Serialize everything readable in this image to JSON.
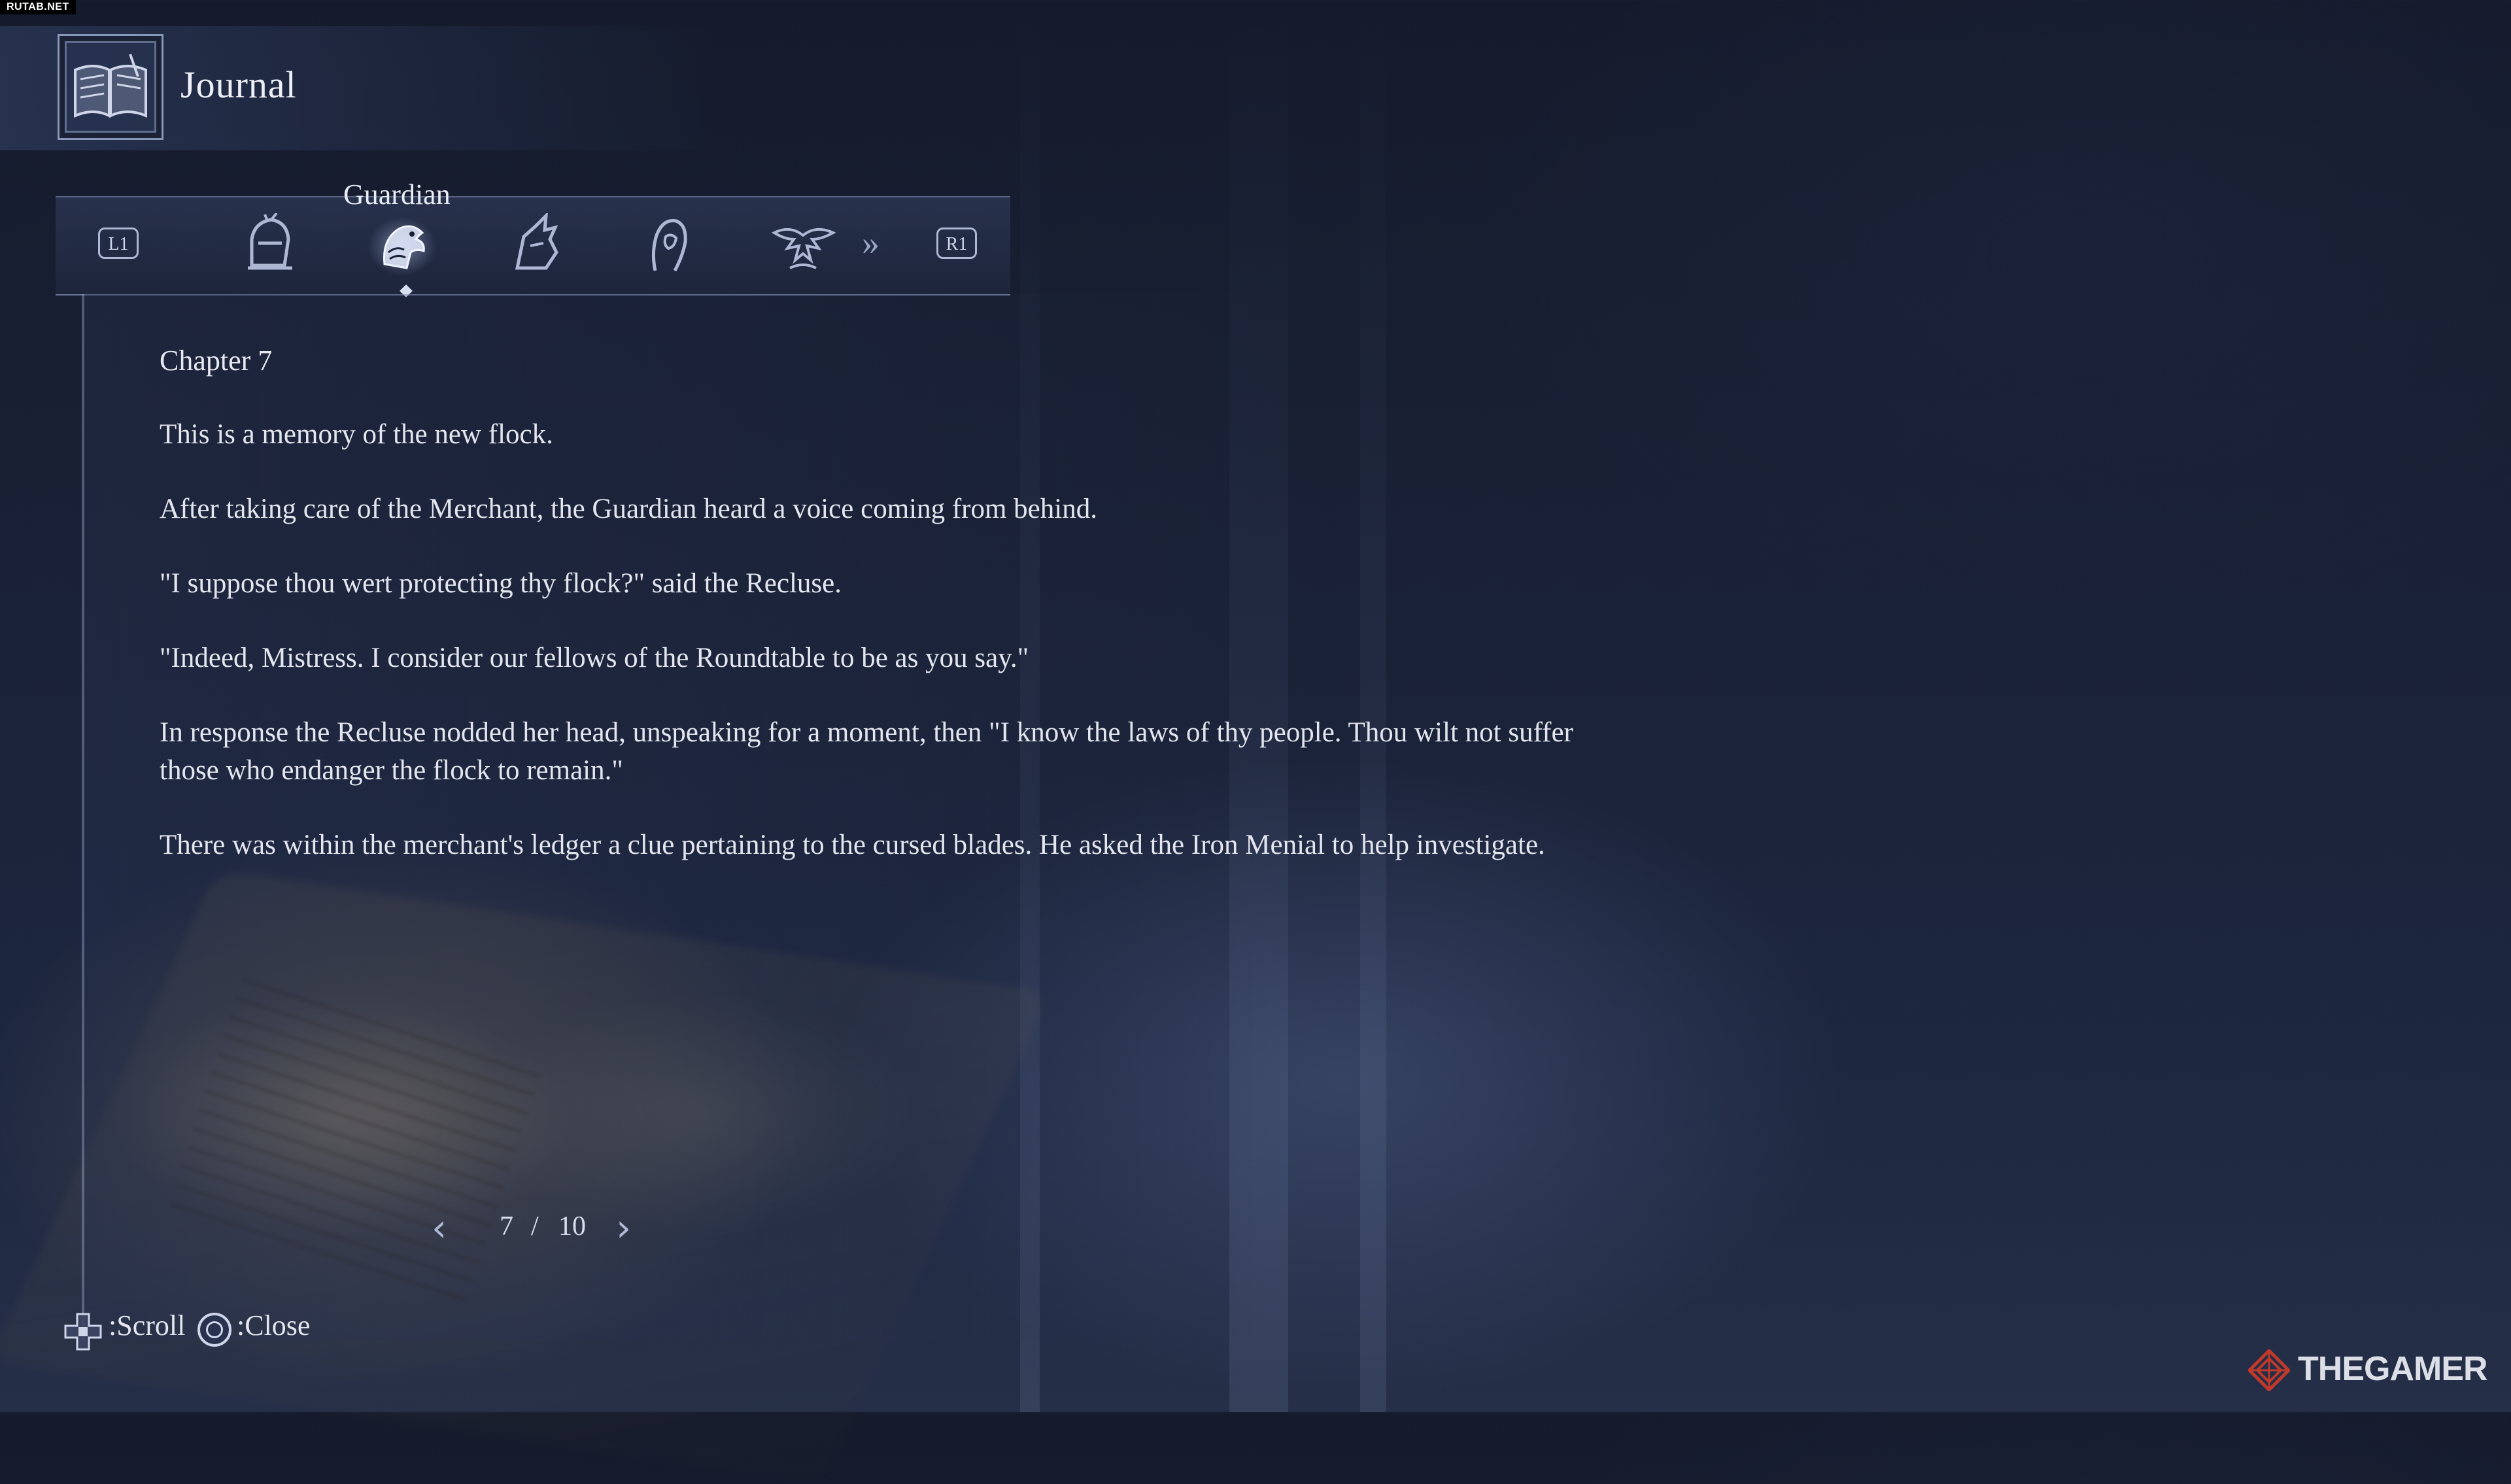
{
  "source_tag": "RUTAB.NET",
  "window": {
    "title": "Journal",
    "icon": "book-icon"
  },
  "tabs": {
    "left_button": "L1",
    "right_button": "R1",
    "active_label": "Guardian",
    "items": [
      {
        "name": "knight-helmet-icon",
        "active": false
      },
      {
        "name": "guardian-bird-icon",
        "active": true
      },
      {
        "name": "raider-icon",
        "active": false
      },
      {
        "name": "hooded-figure-icon",
        "active": false
      },
      {
        "name": "winged-beast-icon",
        "active": false
      }
    ],
    "more_icon": "double-chevron-right-icon"
  },
  "entry": {
    "chapter": "Chapter 7",
    "paragraphs": [
      "This is a memory of the new flock.",
      "After taking care of the Merchant, the Guardian heard a voice coming from behind.",
      "\"I suppose thou wert protecting thy flock?\" said the Recluse.",
      "\"Indeed, Mistress. I consider our fellows of the Roundtable to be as you say.\"",
      "In response the Recluse nodded her head, unspeaking for a moment, then \"I know the laws of thy people. Thou wilt not suffer those who endanger the flock to remain.\"",
      "There was within the merchant's ledger a clue pertaining to the cursed blades. He asked the Iron Menial to help investigate."
    ]
  },
  "pager": {
    "current": "7",
    "separator": "/",
    "total": "10"
  },
  "hints": {
    "scroll": ":Scroll",
    "close": ":Close"
  },
  "watermark": {
    "text": "THEGAMER",
    "accent_color": "#c0392b"
  },
  "colors": {
    "text": "#e6e9f2",
    "accent": "#aeb8d4",
    "background": "#1a2136"
  }
}
